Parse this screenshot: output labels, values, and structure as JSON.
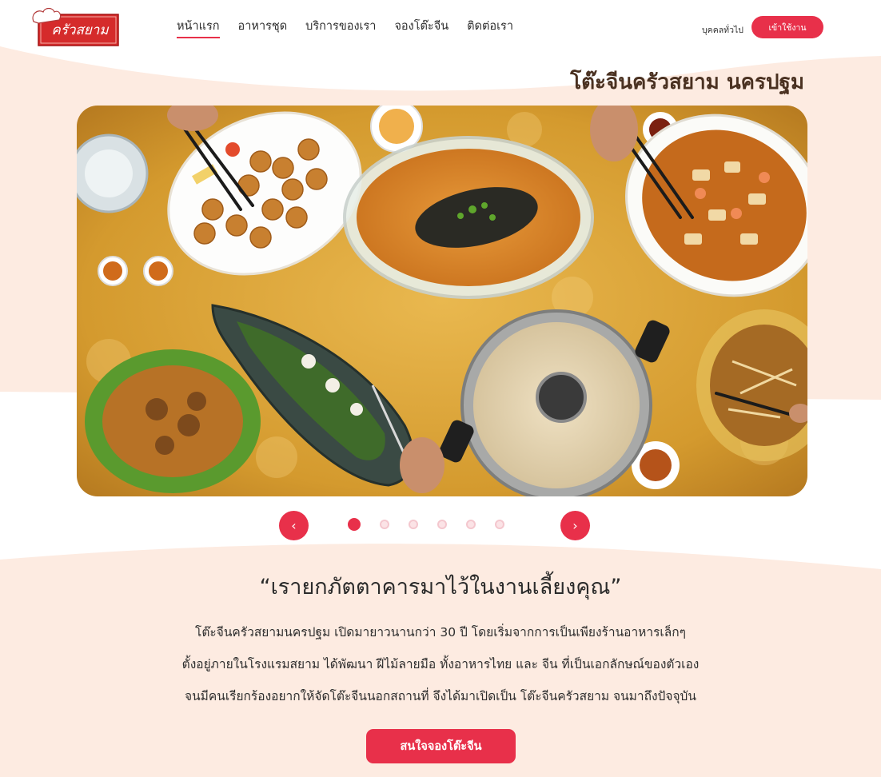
{
  "logo": {
    "text": "ครัวสยาม"
  },
  "nav": {
    "items": [
      {
        "label": "หน้าแรก",
        "active": true
      },
      {
        "label": "อาหารชุด",
        "active": false
      },
      {
        "label": "บริการของเรา",
        "active": false
      },
      {
        "label": "จองโต๊ะจีน",
        "active": false
      },
      {
        "label": "ติดต่อเรา",
        "active": false
      }
    ],
    "general_label": "บุคคลทั่วไป",
    "login_label": "เข้าใช้งาน"
  },
  "hero": {
    "title": "โต๊ะจีนครัวสยาม นครปฐม",
    "slides_total": 6,
    "active_slide": 1
  },
  "carousel": {
    "prev_icon": "chevron-left-icon",
    "next_icon": "chevron-right-icon"
  },
  "about": {
    "quote": "“เรายกภัตตาคารมาไว้ในงานเลี้ยงคุณ”",
    "lines": [
      "โต๊ะจีนครัวสยามนครปฐม เปิดมายาวนานกว่า 30 ปี โดยเริ่มจากการเป็นเพียงร้านอาหารเล็กๆ",
      "ตั้งอยู่ภายในโรงแรมสยาม ได้พัฒนา ฝีไม้ลายมือ ทั้งอาหารไทย และ จีน ที่เป็นเอกลักษณ์ของตัวเอง",
      "จนมีคนเรียกร้องอยากให้จัดโต๊ะจีนนอกสถานที่ จึงได้มาเปิดเป็น โต๊ะจีนครัวสยาม จนมาถึงปัจจุบัน"
    ],
    "cta_label": "สนใจจองโต๊ะจีน"
  },
  "colors": {
    "accent": "#e8304a",
    "wave": "#fdebe1",
    "title": "#4a3121"
  }
}
